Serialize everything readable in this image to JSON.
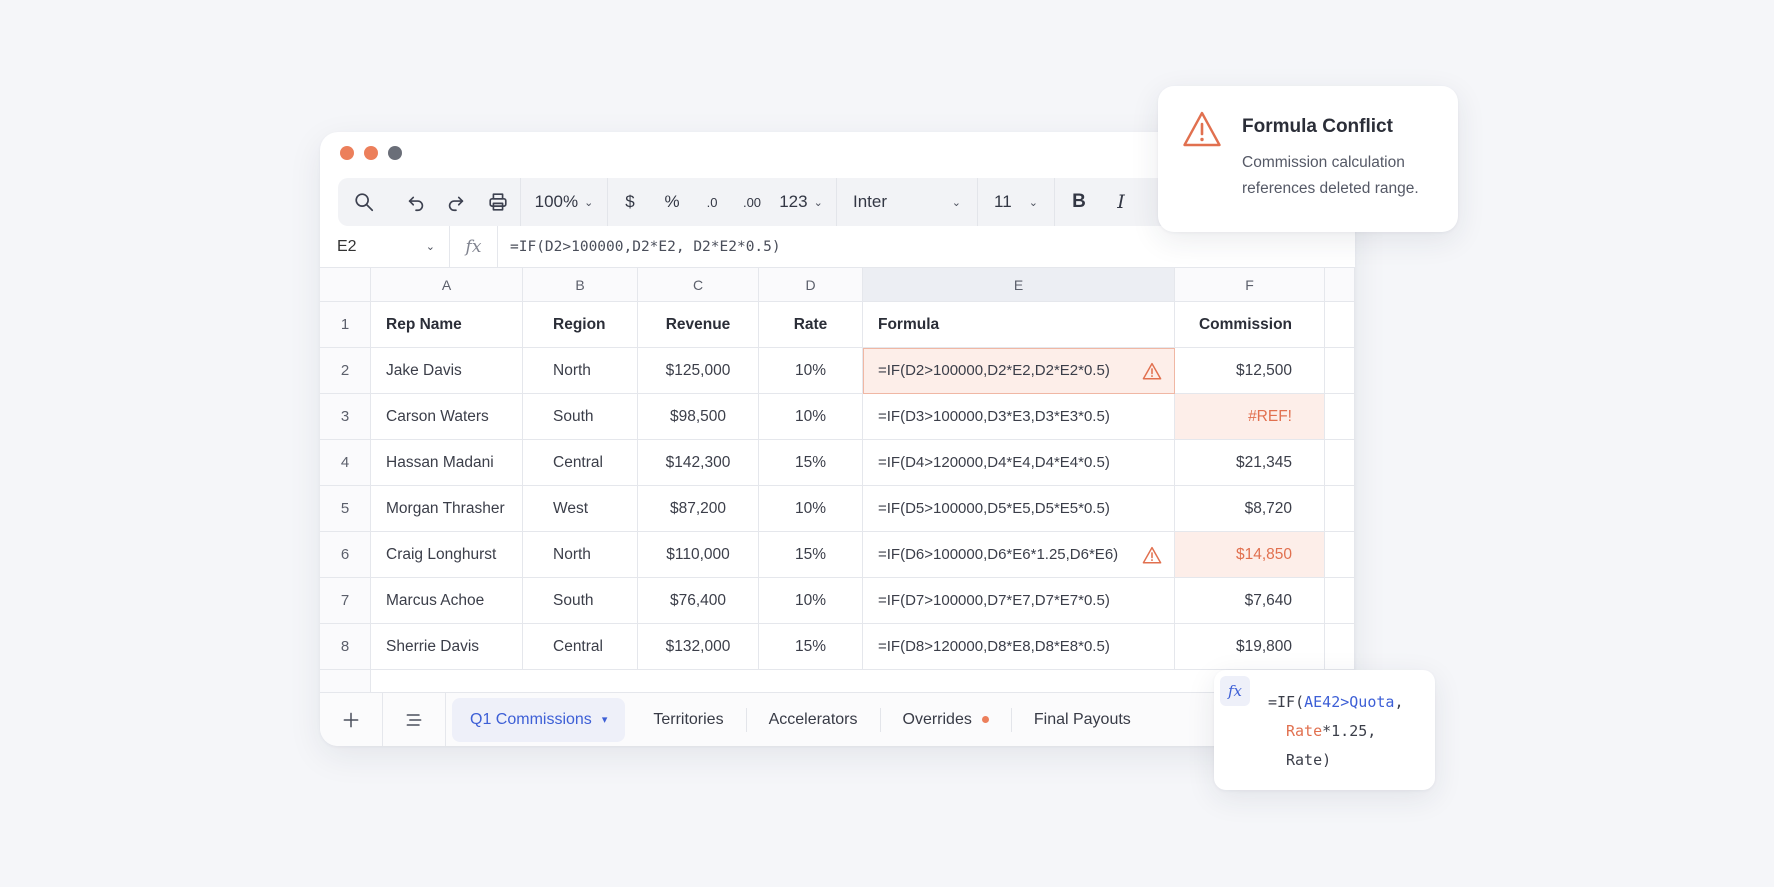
{
  "window": {
    "traffic_colors": [
      "#ec7f5b",
      "#ec7f5b",
      "#6a6e78"
    ]
  },
  "toolbar": {
    "zoom": "100%",
    "currency": "$",
    "percent": "%",
    "decrease_decimal": ".0",
    "increase_decimal": ".00",
    "number_format": "123",
    "font": "Inter",
    "font_size": "11",
    "bold": "B",
    "italic": "I"
  },
  "formula_bar": {
    "cell_ref": "E2",
    "fx": "fx",
    "formula": "=IF(D2>100000,D2*E2, D2*E2*0.5)"
  },
  "columns": [
    "A",
    "B",
    "C",
    "D",
    "E",
    "F"
  ],
  "selected_column": "E",
  "header_row": {
    "num": "1",
    "rep_name": "Rep Name",
    "region": "Region",
    "revenue": "Revenue",
    "rate": "Rate",
    "formula": "Formula",
    "commission": "Commission"
  },
  "rows": [
    {
      "num": "2",
      "name": "Jake Davis",
      "region": "North",
      "revenue": "$125,000",
      "rate": "10%",
      "formula": "=IF(D2>100000,D2*E2,D2*E2*0.5)",
      "commission": "$12,500"
    },
    {
      "num": "3",
      "name": "Carson Waters",
      "region": "South",
      "revenue": "$98,500",
      "rate": "10%",
      "formula": "=IF(D3>100000,D3*E3,D3*E3*0.5)",
      "commission": "#REF!"
    },
    {
      "num": "4",
      "name": "Hassan Madani",
      "region": "Central",
      "revenue": "$142,300",
      "rate": "15%",
      "formula": "=IF(D4>120000,D4*E4,D4*E4*0.5)",
      "commission": "$21,345"
    },
    {
      "num": "5",
      "name": "Morgan Thrasher",
      "region": "West",
      "revenue": "$87,200",
      "rate": "10%",
      "formula": "=IF(D5>100000,D5*E5,D5*E5*0.5)",
      "commission": "$8,720"
    },
    {
      "num": "6",
      "name": "Craig Longhurst",
      "region": "North",
      "revenue": "$110,000",
      "rate": "15%",
      "formula": "=IF(D6>100000,D6*E6*1.25,D6*E6)",
      "commission": "$14,850"
    },
    {
      "num": "7",
      "name": "Marcus Achoe",
      "region": "South",
      "revenue": "$76,400",
      "rate": "10%",
      "formula": "=IF(D7>100000,D7*E7,D7*E7*0.5)",
      "commission": "$7,640"
    },
    {
      "num": "8",
      "name": "Sherrie Davis",
      "region": "Central",
      "revenue": "$132,000",
      "rate": "15%",
      "formula": "=IF(D8>120000,D8*E8,D8*E8*0.5)",
      "commission": "$19,800"
    }
  ],
  "tabs": {
    "active": "Q1 Commissions",
    "territories": "Territories",
    "accelerators": "Accelerators",
    "overrides": "Overrides",
    "final_payouts": "Final Payouts"
  },
  "conflict_popup": {
    "title": "Formula Conflict",
    "body": "Commission calculation references deleted range."
  },
  "formula_hint": {
    "fx": "fx",
    "line1_prefix": "=IF(",
    "line1_ref": "AE42>Quota",
    "line1_suffix": ",",
    "line2_var": "Rate",
    "line2_rest": "*1.25,",
    "line3": "Rate)"
  },
  "colors": {
    "accent": "#3d5fd6",
    "warning": "#e1704f",
    "warning_bg": "#fdeee9"
  }
}
